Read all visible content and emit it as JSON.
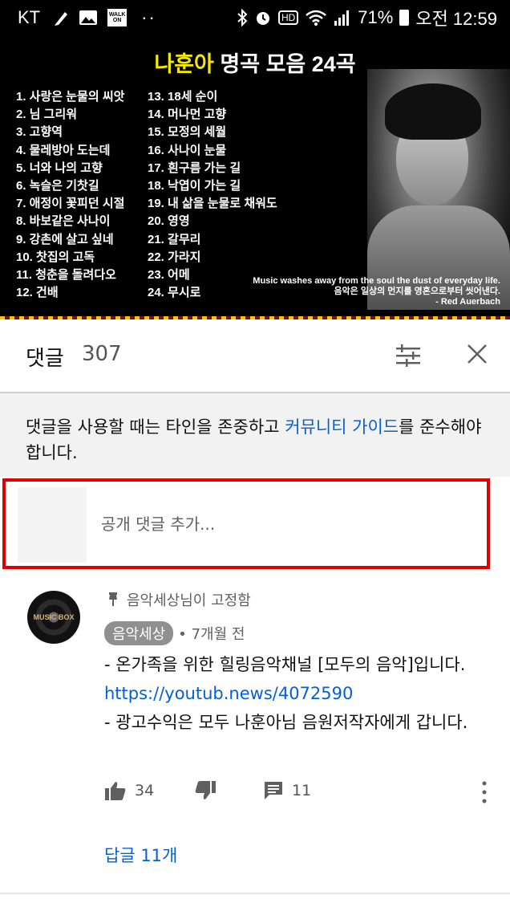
{
  "status_bar": {
    "carrier": "KT",
    "walk_label": "WALK ON",
    "hd_label": "HD",
    "battery": "71%",
    "time": "오전 12:59"
  },
  "video": {
    "title_name": "나훈아",
    "title_rest": " 명곡 모음 24곡",
    "songs_col1": [
      "1. 사랑은 눈물의 씨앗",
      "2. 님 그리워",
      "3. 고향역",
      "4. 물레방아 도는데",
      "5. 너와 나의 고향",
      "6. 녹슬은 기찻길",
      "7. 애정이 꽃피던 시절",
      "8. 바보같은 사나이",
      "9. 강촌에 살고 싶네",
      "10. 찻집의 고독",
      "11. 청춘을 돌려다오",
      "12. 건배"
    ],
    "songs_col2": [
      "13. 18세 순이",
      "14. 머나먼 고향",
      "15. 모정의 세월",
      "16. 사나이 눈물",
      "17. 흰구름 가는 길",
      "18. 낙엽이 가는 길",
      "19. 내 삶을 눈물로 채워도",
      "20. 영영",
      "21. 갈무리",
      "22. 가라지",
      "23. 어메",
      "24. 무시로"
    ],
    "quote_en": "Music washes away from the soul the dust of everyday life.",
    "quote_kr": "음악은 일상의 먼지를 영혼으로부터 씻어낸다.",
    "quote_author": "- Red Auerbach"
  },
  "comments_header": {
    "title": "댓글",
    "count": "307"
  },
  "guidelines": {
    "before": "댓글을 사용할 때는 타인을 존중하고 ",
    "link": "커뮤니티 가이드",
    "after": "를 준수해야 합니다."
  },
  "add_comment": {
    "placeholder": "공개 댓글 추가..."
  },
  "comment": {
    "avatar_label": "MUSIC BOX",
    "pinned_text": "음악세상님이 고정함",
    "author": "음악세상",
    "time": "• 7개월 전",
    "line1": "- 온가족을 위한 힐링음악채널 [모두의 음악]입니다. ",
    "link": "https://youtub.news/4072590",
    "line2": "- 광고수익은 모두 나훈아님 음원저작자에게 갑니다.",
    "likes": "34",
    "reply_count": "11",
    "view_replies": "답글 11개"
  },
  "colors": {
    "link_blue": "#065fd4",
    "highlight_red": "#e00000",
    "title_yellow": "#f5e800"
  },
  "icons": [
    "bluetooth-icon",
    "alarm-icon",
    "wifi-icon",
    "signal-icon",
    "battery-icon",
    "sort-icon",
    "close-icon",
    "pin-icon",
    "thumbs-up-icon",
    "thumbs-down-icon",
    "reply-icon",
    "more-vert-icon"
  ]
}
